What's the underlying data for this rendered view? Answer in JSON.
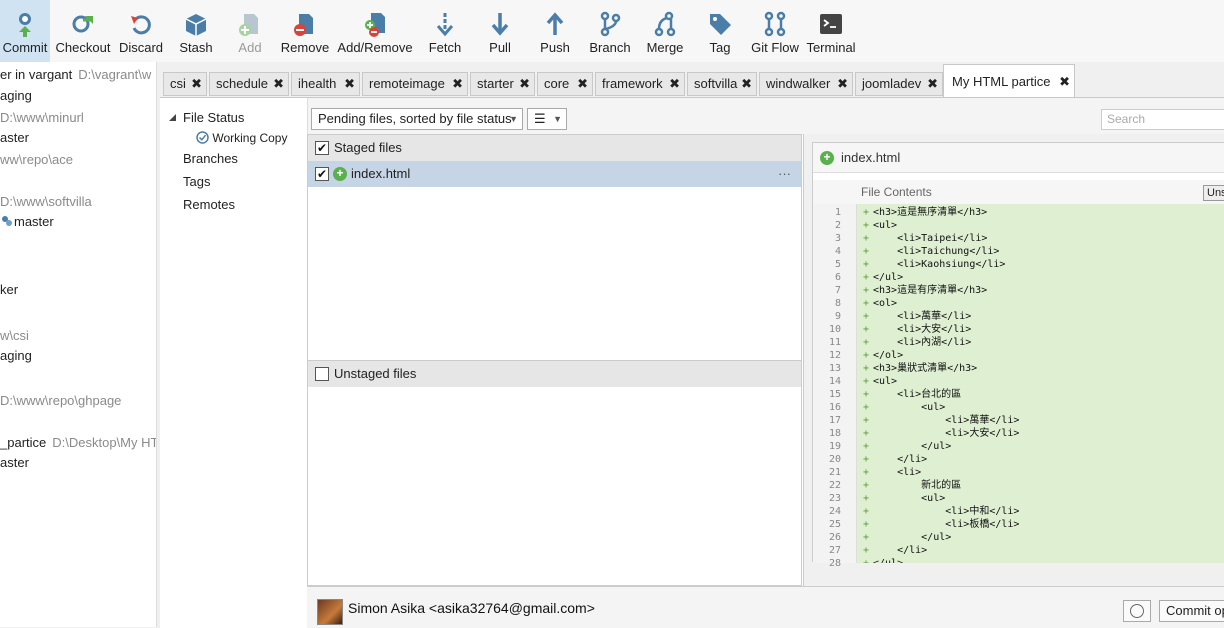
{
  "toolbar": {
    "buttons": [
      {
        "label": "Commit"
      },
      {
        "label": "Checkout"
      },
      {
        "label": "Discard"
      },
      {
        "label": "Stash"
      },
      {
        "label": "Add"
      },
      {
        "label": "Remove"
      },
      {
        "label": "Add/Remove"
      },
      {
        "label": "Fetch"
      },
      {
        "label": "Pull"
      },
      {
        "label": "Push"
      },
      {
        "label": "Branch"
      },
      {
        "label": "Merge"
      },
      {
        "label": "Tag"
      },
      {
        "label": "Git Flow"
      },
      {
        "label": "Terminal"
      }
    ]
  },
  "repos": [
    {
      "name": "er in vargant",
      "path": "D:\\vagrant\\w"
    },
    {
      "sub": "aging"
    },
    {
      "path": "D:\\www\\minurl"
    },
    {
      "sub": "aster"
    },
    {
      "path": "ww\\repo\\ace"
    },
    {
      "path": "D:\\www\\softvilla"
    },
    {
      "sub": "master"
    },
    {
      "name": "ker"
    },
    {
      "path": "w\\csi"
    },
    {
      "sub": "aging"
    },
    {
      "path": "D:\\www\\repo\\ghpage"
    },
    {
      "name": "_partice",
      "path": "D:\\Desktop\\My HT"
    },
    {
      "sub": "aster"
    }
  ],
  "tabs": [
    {
      "label": "csi"
    },
    {
      "label": "schedule"
    },
    {
      "label": "ihealth"
    },
    {
      "label": "remoteimage"
    },
    {
      "label": "starter"
    },
    {
      "label": "core"
    },
    {
      "label": "framework"
    },
    {
      "label": "softvilla"
    },
    {
      "label": "windwalker"
    },
    {
      "label": "joomladev"
    },
    {
      "label": "My HTML partice"
    }
  ],
  "tab_close_glyph": "✖",
  "sidebar": {
    "file_status": "File Status",
    "working_copy": "Working Copy",
    "branches": "Branches",
    "tags": "Tags",
    "remotes": "Remotes"
  },
  "filters": {
    "sort_label": "Pending files, sorted by file status",
    "view_glyph": "☰",
    "search_placeholder": "Search"
  },
  "staged": {
    "header": "Staged files",
    "files": [
      {
        "name": "index.html",
        "status": "added"
      }
    ],
    "more": "···"
  },
  "unstaged": {
    "header": "Unstaged files"
  },
  "diff": {
    "filename": "index.html",
    "contents_label": "File Contents",
    "unstage_label": "Unstage hunk",
    "lines": [
      "<h3>這是無序清單</h3>",
      "<ul>",
      "    <li>Taipei</li>",
      "    <li>Taichung</li>",
      "    <li>Kaohsiung</li>",
      "</ul>",
      "<h3>這是有序清單</h3>",
      "<ol>",
      "    <li>萬華</li>",
      "    <li>大安</li>",
      "    <li>內湖</li>",
      "</ol>",
      "<h3>巢狀式清單</h3>",
      "<ul>",
      "    <li>台北的區",
      "        <ul>",
      "            <li>萬華</li>",
      "            <li>大安</li>",
      "        </ul>",
      "    </li>",
      "    <li>",
      "        新北的區",
      "        <ul>",
      "            <li>中和</li>",
      "            <li>板橋</li>",
      "        </ul>",
      "    </li>",
      "</ul>"
    ]
  },
  "commit": {
    "author": "Simon Asika <asika32764@gmail.com>",
    "options_label": "Commit options"
  },
  "colors": {
    "added_bg": "#dff0d2",
    "selected_row": "#c5d5e5",
    "add_green": "#5ab04c",
    "remove_red": "#d9443a",
    "icon_blue": "#4a7ea8"
  }
}
